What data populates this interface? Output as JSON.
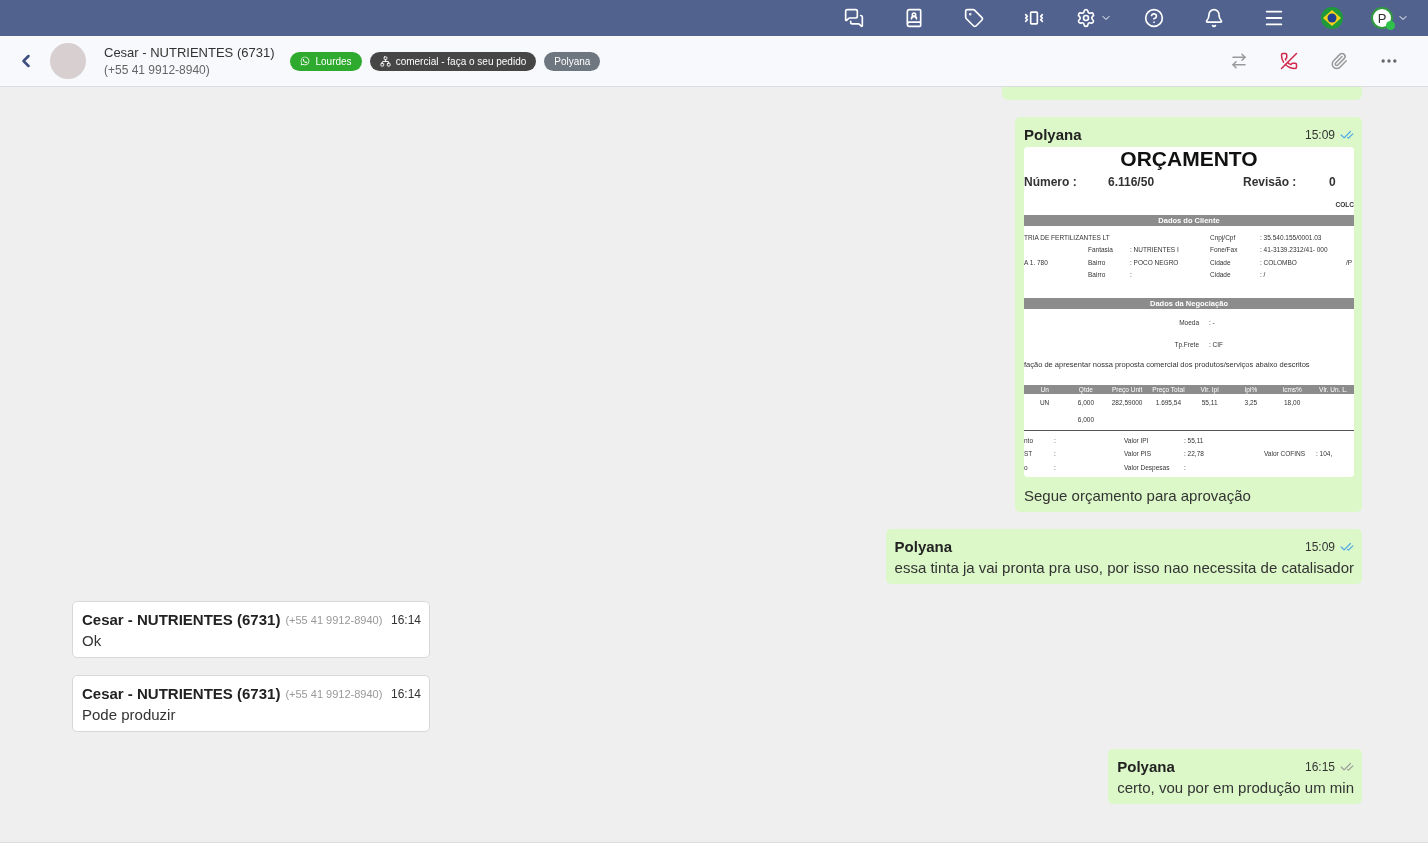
{
  "topbar": {
    "user_initial": "P",
    "user_online": true
  },
  "contact": {
    "name": "Cesar - NUTRIENTES (6731)",
    "phone": "(+55 41 9912-8940)",
    "tags": [
      {
        "kind": "whatsapp",
        "label": "Lourdes",
        "color": "#2eaa2e"
      },
      {
        "kind": "department",
        "label": "comercial - faça o seu pedido",
        "color": "#464646"
      },
      {
        "kind": "agent",
        "label": "Polyana",
        "color": "#6e7680"
      }
    ]
  },
  "messages": [
    {
      "kind": "image",
      "outgoing": true,
      "sender": "Polyana",
      "time": "15:09",
      "read": true,
      "caption": "Segue orçamento para aprovação",
      "document": {
        "title": "ORÇAMENTO",
        "number_label": "Número :",
        "number": "6.116/50",
        "revision_label": "Revisão :",
        "revision": "0",
        "corner": "COLC",
        "client_heading": "Dados do Cliente",
        "client_rows": [
          [
            "TRIA DE FERTILIZANTES LT",
            "",
            "",
            "Cnpj/Cpf",
            ": 35.540.155/0001.03",
            ""
          ],
          [
            "",
            "Fantasia",
            ": NUTRIENTES I",
            "Fone/Fax",
            ": 41-3139.2312/41- 000",
            ""
          ],
          [
            "A 1. 780",
            "Bairro",
            ": POCO NEGRO",
            "Cidade",
            ": COLOMBO",
            "/P"
          ],
          [
            "",
            "Bairro",
            ":",
            "Cidade",
            ": /",
            ""
          ]
        ],
        "deal_heading": "Dados da Negociação",
        "deal_rows": [
          [
            "Moeda",
            ": -"
          ],
          [
            "Tp.Frete",
            ": CIF"
          ]
        ],
        "intro": "fação de apresentar nossa proposta comercial dos produtos/serviços abaixo descritos",
        "item_columns": [
          "Un",
          "Qtde",
          "Preço Unit",
          "Preço Total",
          "Vlr. Ipi",
          "Ipi%",
          "Icms%",
          "Vlr. Un. L."
        ],
        "item_rows": [
          [
            "UN",
            "6,000",
            "282,59000",
            "1.695,54",
            "55,11",
            "3,25",
            "18,00",
            ""
          ],
          [
            "",
            "6,000",
            "",
            "",
            "",
            "",
            "",
            ""
          ]
        ],
        "total_rows": [
          [
            "nto",
            ":",
            "Valor IPI",
            ": 55,11",
            "",
            ""
          ],
          [
            "ST",
            ":",
            "Valor PIS",
            ": 22,78",
            "Valor COFINS",
            ": 104,"
          ],
          [
            "o",
            ":",
            "Valor Despesas",
            ":",
            "",
            ""
          ]
        ]
      }
    },
    {
      "kind": "text",
      "outgoing": true,
      "sender": "Polyana",
      "time": "15:09",
      "read": true,
      "text": "essa tinta ja vai pronta pra uso, por isso nao necessita de catalisador"
    },
    {
      "kind": "text",
      "outgoing": false,
      "sender": "Cesar - NUTRIENTES (6731)",
      "phone": "(+55 41 9912-8940)",
      "time": "16:14",
      "text": "Ok"
    },
    {
      "kind": "text",
      "outgoing": false,
      "sender": "Cesar - NUTRIENTES (6731)",
      "phone": "(+55 41 9912-8940)",
      "time": "16:14",
      "text": "Pode produzir"
    },
    {
      "kind": "text",
      "outgoing": true,
      "sender": "Polyana",
      "time": "16:15",
      "read": false,
      "text": "certo, vou por em produção um min"
    }
  ]
}
